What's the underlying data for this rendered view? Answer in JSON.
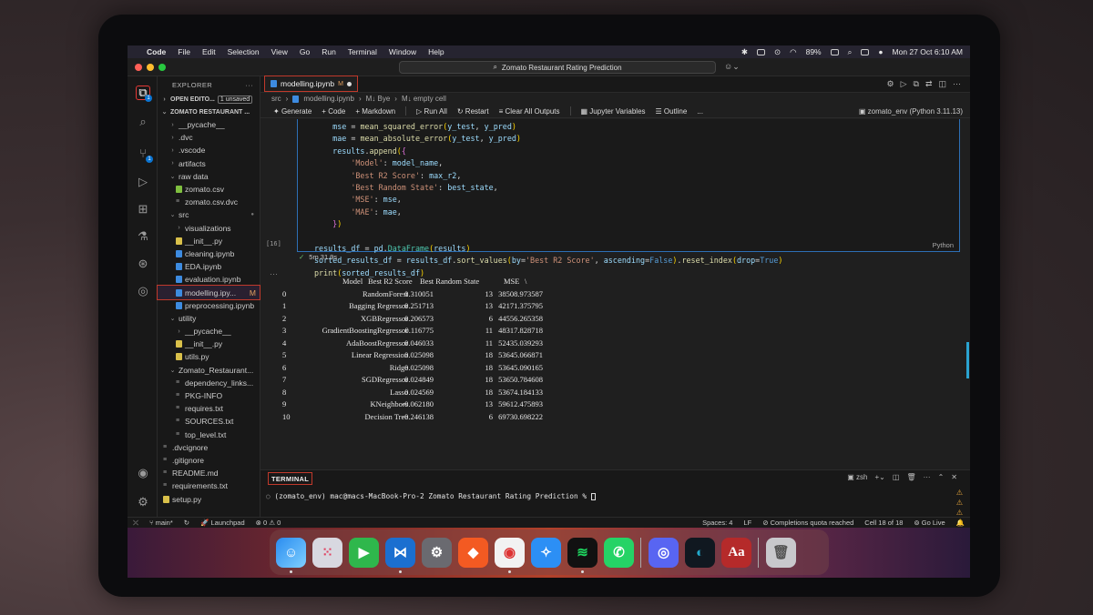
{
  "menubar": {
    "app": "Code",
    "items": [
      "File",
      "Edit",
      "Selection",
      "View",
      "Go",
      "Run",
      "Terminal",
      "Window",
      "Help"
    ],
    "battery": "89%",
    "datetime": "Mon 27 Oct  6:10 AM"
  },
  "titlebar": {
    "search": "Zomato Restaurant Rating Prediction"
  },
  "explorer": {
    "title": "EXPLORER",
    "open_editors": "OPEN EDITO...",
    "unsaved": "1 unsaved",
    "root": "ZOMATO RESTAURANT ...",
    "items": [
      {
        "label": "__pycache__",
        "type": "folder"
      },
      {
        "label": ".dvc",
        "type": "folder"
      },
      {
        "label": ".vscode",
        "type": "folder"
      },
      {
        "label": "artifacts",
        "type": "folder"
      },
      {
        "label": "raw data",
        "type": "folder-open"
      },
      {
        "label": "zomato.csv",
        "type": "csv"
      },
      {
        "label": "zomato.csv.dvc",
        "type": "txt"
      },
      {
        "label": "src",
        "type": "folder-open"
      },
      {
        "label": "visualizations",
        "type": "folder"
      },
      {
        "label": "__init__.py",
        "type": "py"
      },
      {
        "label": "cleaning.ipynb",
        "type": "nb"
      },
      {
        "label": "EDA.ipynb",
        "type": "nb"
      },
      {
        "label": "evaluation.ipynb",
        "type": "nb"
      },
      {
        "label": "modelling.ipy...",
        "type": "nb",
        "mod": "M"
      },
      {
        "label": "preprocessing.ipynb",
        "type": "nb"
      },
      {
        "label": "utility",
        "type": "folder-open"
      },
      {
        "label": "__pycache__",
        "type": "folder"
      },
      {
        "label": "__init__.py",
        "type": "py"
      },
      {
        "label": "utils.py",
        "type": "py"
      },
      {
        "label": "Zomato_Restaurant...",
        "type": "folder-open"
      },
      {
        "label": "dependency_links...",
        "type": "txt"
      },
      {
        "label": "PKG-INFO",
        "type": "txt"
      },
      {
        "label": "requires.txt",
        "type": "txt"
      },
      {
        "label": "SOURCES.txt",
        "type": "txt"
      },
      {
        "label": "top_level.txt",
        "type": "txt"
      },
      {
        "label": ".dvcignore",
        "type": "txt"
      },
      {
        "label": ".gitignore",
        "type": "txt"
      },
      {
        "label": "README.md",
        "type": "txt"
      },
      {
        "label": "requirements.txt",
        "type": "txt"
      },
      {
        "label": "setup.py",
        "type": "py"
      }
    ]
  },
  "editor": {
    "tab_label": "modelling.ipynb",
    "tab_modified": "M",
    "breadcrumb": [
      "src",
      "modelling.ipynb",
      "M↓ Bye",
      "M↓ empty cell"
    ],
    "toolbar": [
      "Generate",
      "+ Code",
      "+ Markdown",
      "Run All",
      "Restart",
      "Clear All Outputs",
      "Jupyter Variables",
      "Outline",
      "..."
    ],
    "kernel": "zomato_env (Python 3.11.13)",
    "exec_count": "[16]",
    "duration": "5m 31.9s",
    "lang": "Python"
  },
  "output_header": [
    "Model",
    "Best R2 Score",
    "Best Random State",
    "MSE",
    "\\"
  ],
  "output_rows": [
    [
      "0",
      "RandomForest",
      "0.310051",
      "13",
      "38508.973587"
    ],
    [
      "1",
      "Bagging Regressor",
      "0.251713",
      "13",
      "42171.375795"
    ],
    [
      "2",
      "XGBRegressor",
      "0.206573",
      "6",
      "44556.265358"
    ],
    [
      "3",
      "GradientBoostingRegressor",
      "0.116775",
      "11",
      "48317.828718"
    ],
    [
      "4",
      "AdaBoostRegressor",
      "0.046033",
      "11",
      "52435.039293"
    ],
    [
      "5",
      "Linear Regression",
      "0.025098",
      "18",
      "53645.066871"
    ],
    [
      "6",
      "Ridge",
      "0.025098",
      "18",
      "53645.090165"
    ],
    [
      "7",
      "SGDRegressor",
      "0.024849",
      "18",
      "53650.784608"
    ],
    [
      "8",
      "Lasso",
      "0.024569",
      "18",
      "53674.184133"
    ],
    [
      "9",
      "KNeighbors",
      "-0.062180",
      "13",
      "59612.475893"
    ],
    [
      "10",
      "Decision Tree",
      "-0.246138",
      "6",
      "69730.698222"
    ]
  ],
  "terminal": {
    "tab": "TERMINAL",
    "shell": "zsh",
    "line": "(zomato_env) mac@macs-MacBook-Pro-2 Zomato Restaurant Rating Prediction % "
  },
  "statusbar": {
    "branch": "main*",
    "launchpad": "Launchpad",
    "problems": "0",
    "warnings": "0",
    "spaces": "Spaces: 4",
    "eol": "LF",
    "completions": "Completions quota reached",
    "cell": "Cell 18 of 18",
    "golive": "Go Live"
  },
  "colors": {
    "accent_red": "#c0392b",
    "cell_border": "#2d6fb5",
    "statusbar_bg": "#181818"
  }
}
